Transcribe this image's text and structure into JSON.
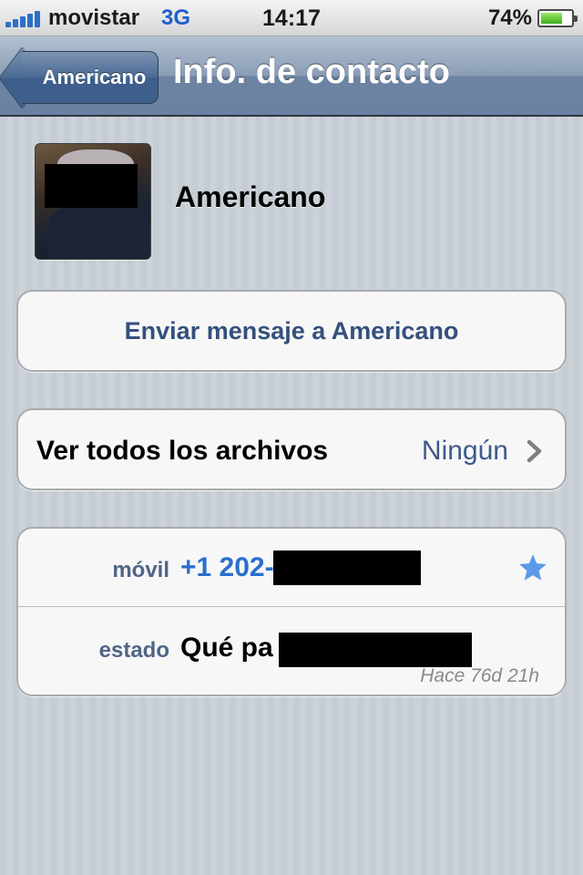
{
  "status_bar": {
    "carrier": "movistar",
    "network": "3G",
    "time": "14:17",
    "battery_percent": "74%",
    "battery_level": 0.74
  },
  "nav": {
    "back_label": "Americano",
    "title": "Info. de contacto"
  },
  "contact": {
    "name": "Americano"
  },
  "actions": {
    "send_message_label": "Enviar mensaje a Americano"
  },
  "files": {
    "label": "Ver todos los archivos",
    "value": "Ningún"
  },
  "details": {
    "phone_label": "móvil",
    "phone_value": "+1 202-",
    "status_label": "estado",
    "status_value": "Qué pa",
    "status_time": "Hace 76d 21h"
  },
  "colors": {
    "accent_blue": "#2a6fce",
    "button_text": "#34507d",
    "label_blue": "#4f6587"
  }
}
